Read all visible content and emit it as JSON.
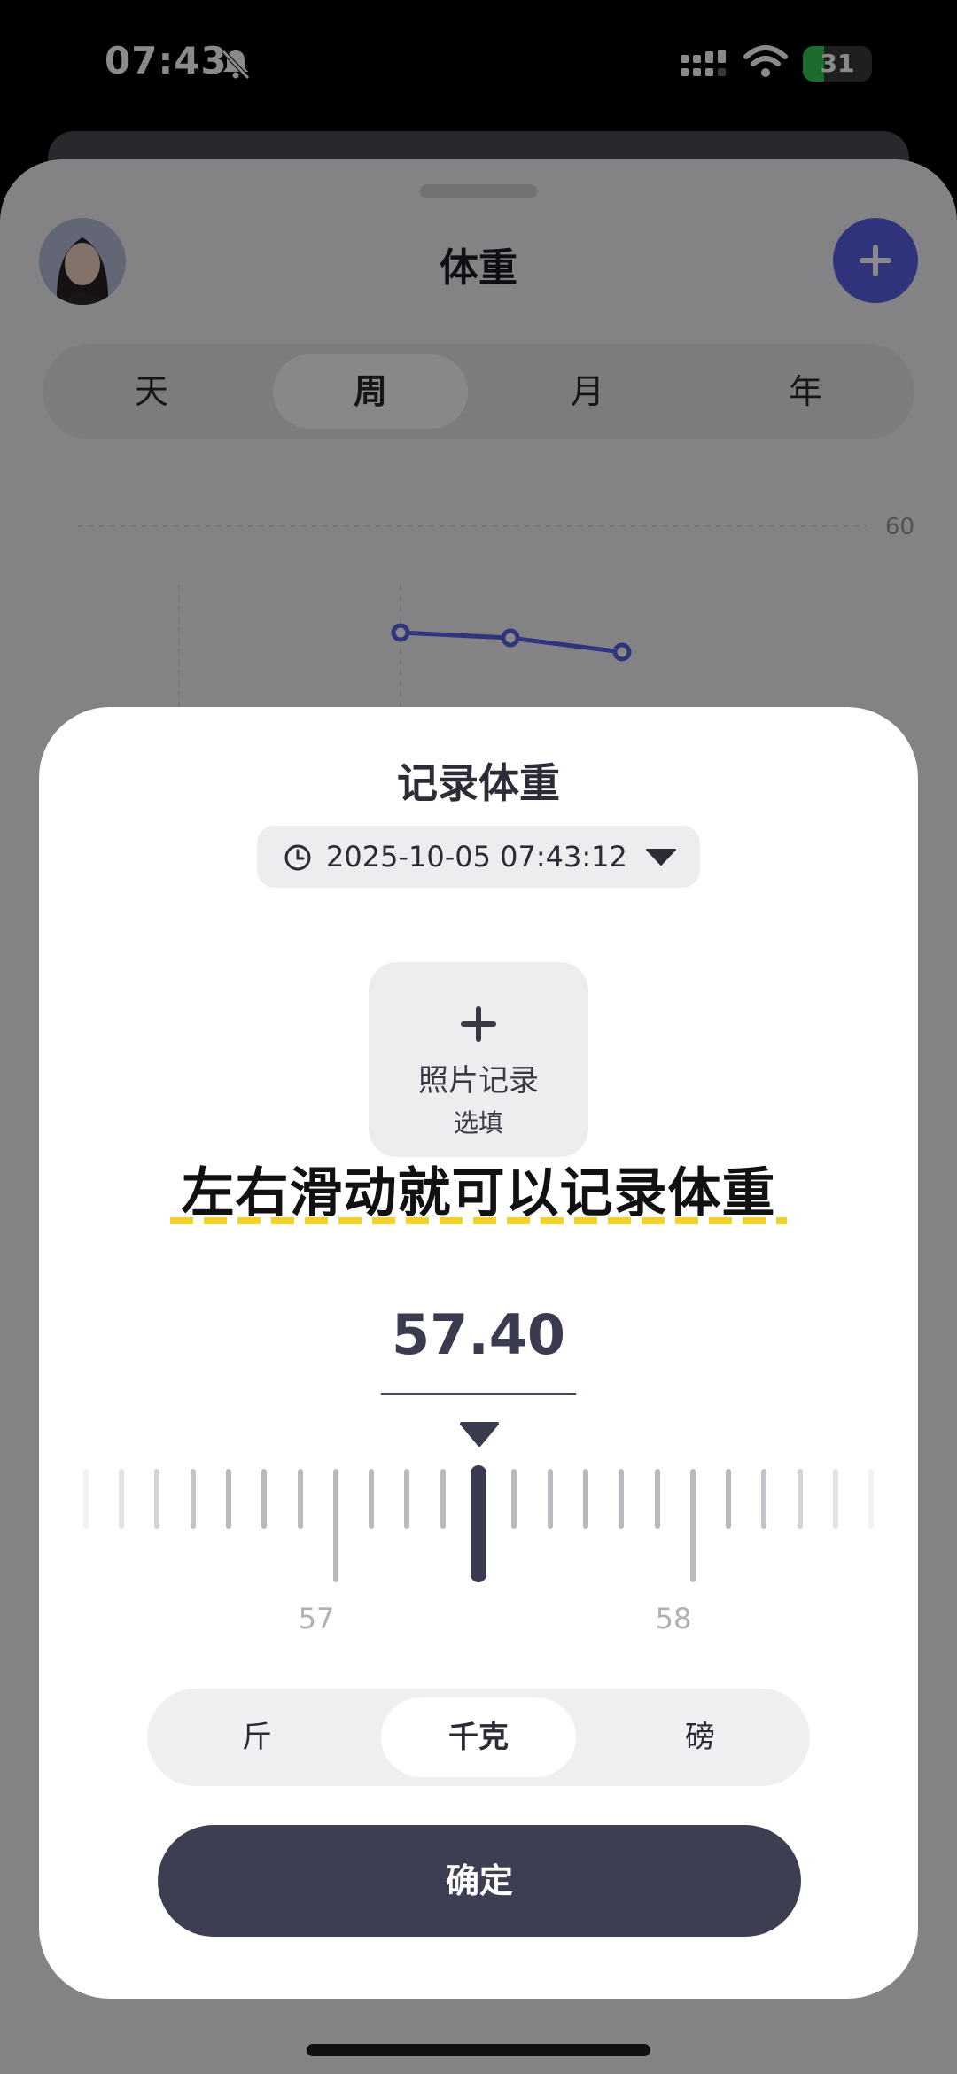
{
  "status_bar": {
    "time": "07:43",
    "battery": "31",
    "battery_level": 0.31,
    "icons": [
      "bell-slash-icon",
      "signal-icon",
      "wifi-icon",
      "battery-icon"
    ]
  },
  "background_screen": {
    "title": "体重",
    "periods": [
      "天",
      "周",
      "月",
      "年"
    ],
    "active_period": "周",
    "chart_tick": "60",
    "accent": "#5a60e8"
  },
  "modal": {
    "title": "记录体重",
    "datetime": "2025-10-05 07:43:12",
    "photo": {
      "label": "照片记录",
      "sub": "选填"
    },
    "caption": "左右滑动就可以记录体重",
    "weight": "57.40",
    "ruler": {
      "label_left": "57",
      "label_right": "58"
    },
    "units": [
      "斤",
      "千克",
      "磅"
    ],
    "active_unit": "千克",
    "confirm": "确定"
  },
  "colors": {
    "primary_dark": "#3d3e52",
    "caption_underline": "#f2d22a"
  }
}
